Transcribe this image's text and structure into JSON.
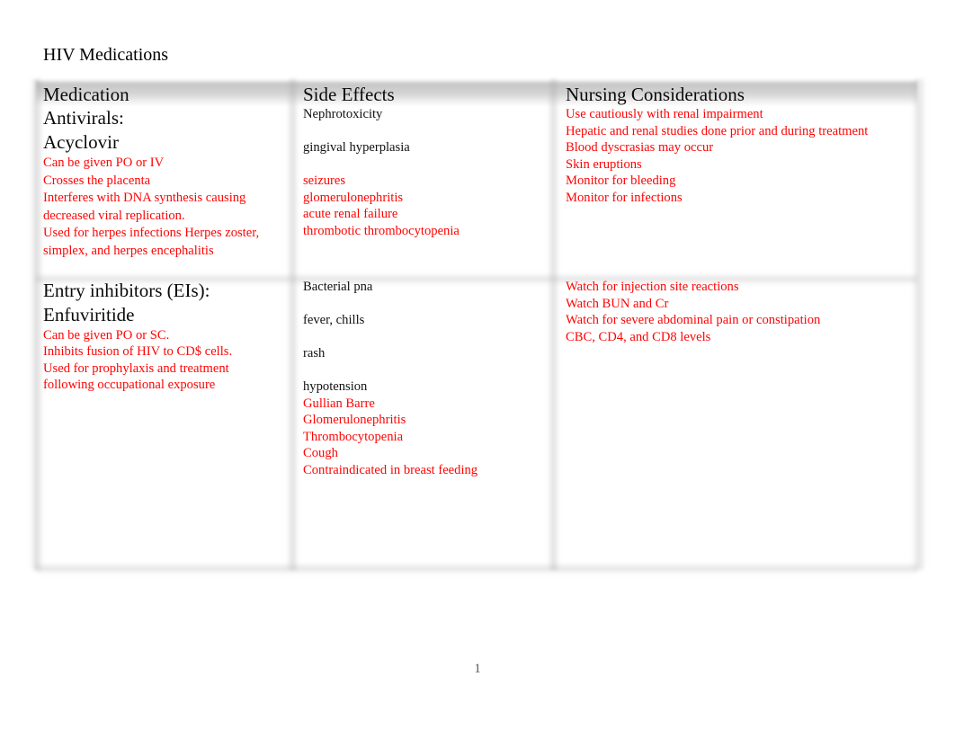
{
  "document": {
    "title": "HIV Medications",
    "page_number": "1"
  },
  "colors": {
    "body_red": "#ff0000",
    "body_black": "#111111",
    "heading_black": "#0a0a0a",
    "header_band_gray": "#a0a0a0",
    "page_background": "#ffffff"
  },
  "table": {
    "headers": {
      "medication": "Medication",
      "side_effects": "Side Effects",
      "nursing_considerations": "Nursing Considerations"
    },
    "rows": [
      {
        "medication": {
          "name_line_1": "Antivirals:",
          "name_line_2": "Acyclovir",
          "details": [
            {
              "text": "Can be given PO or IV",
              "color": "red"
            },
            {
              "text": "Crosses the placenta",
              "color": "red"
            },
            {
              "text": "Interferes with DNA synthesis causing",
              "color": "red"
            },
            {
              "text": "decreased viral replication.",
              "color": "red"
            },
            {
              "text": "Used for herpes infections Herpes zoster,",
              "color": "red"
            },
            {
              "text": "simplex, and herpes encephalitis",
              "color": "red"
            }
          ]
        },
        "side_effects": [
          {
            "text": "Nephrotoxicity",
            "color": "black"
          },
          {
            "text": "",
            "color": "gap"
          },
          {
            "text": "gingival hyperplasia",
            "color": "black"
          },
          {
            "text": "",
            "color": "gap"
          },
          {
            "text": "seizures",
            "color": "red"
          },
          {
            "text": "glomerulonephritis",
            "color": "red"
          },
          {
            "text": "acute renal failure",
            "color": "red"
          },
          {
            "text": "thrombotic thrombocytopenia",
            "color": "red"
          }
        ],
        "nursing_considerations": [
          {
            "text": "Use cautiously with renal impairment",
            "color": "red"
          },
          {
            "text": "Hepatic and renal studies done prior and during treatment",
            "color": "red"
          },
          {
            "text": "Blood dyscrasias may occur",
            "color": "red"
          },
          {
            "text": "Skin eruptions",
            "color": "red"
          },
          {
            "text": "Monitor for bleeding",
            "color": "red"
          },
          {
            "text": "Monitor for infections",
            "color": "red"
          }
        ]
      },
      {
        "medication": {
          "name_line_1": "Entry inhibitors (EIs):",
          "name_line_2": "Enfuviritide",
          "details": [
            {
              "text": "Can be given PO or SC.",
              "color": "red"
            },
            {
              "text": "Inhibits fusion of HIV to CD$ cells.",
              "color": "red"
            },
            {
              "text": "Used for prophylaxis and treatment",
              "color": "red"
            },
            {
              "text": "following occupational exposure",
              "color": "red"
            }
          ]
        },
        "side_effects": [
          {
            "text": "Bacterial pna",
            "color": "black"
          },
          {
            "text": "",
            "color": "gap"
          },
          {
            "text": "fever, chills",
            "color": "black"
          },
          {
            "text": "",
            "color": "gap"
          },
          {
            "text": "rash",
            "color": "black"
          },
          {
            "text": "",
            "color": "gap"
          },
          {
            "text": "hypotension",
            "color": "black"
          },
          {
            "text": "Gullian Barre",
            "color": "red"
          },
          {
            "text": "Glomerulonephritis",
            "color": "red"
          },
          {
            "text": "Thrombocytopenia",
            "color": "red"
          },
          {
            "text": "Cough",
            "color": "red"
          },
          {
            "text": "Contraindicated in breast feeding",
            "color": "red"
          }
        ],
        "nursing_considerations": [
          {
            "text": "Watch for injection site reactions",
            "color": "red"
          },
          {
            "text": "Watch BUN and Cr",
            "color": "red"
          },
          {
            "text": "Watch for severe abdominal pain or constipation",
            "color": "red"
          },
          {
            "text": "CBC, CD4, and CD8 levels",
            "color": "red"
          }
        ]
      }
    ]
  }
}
